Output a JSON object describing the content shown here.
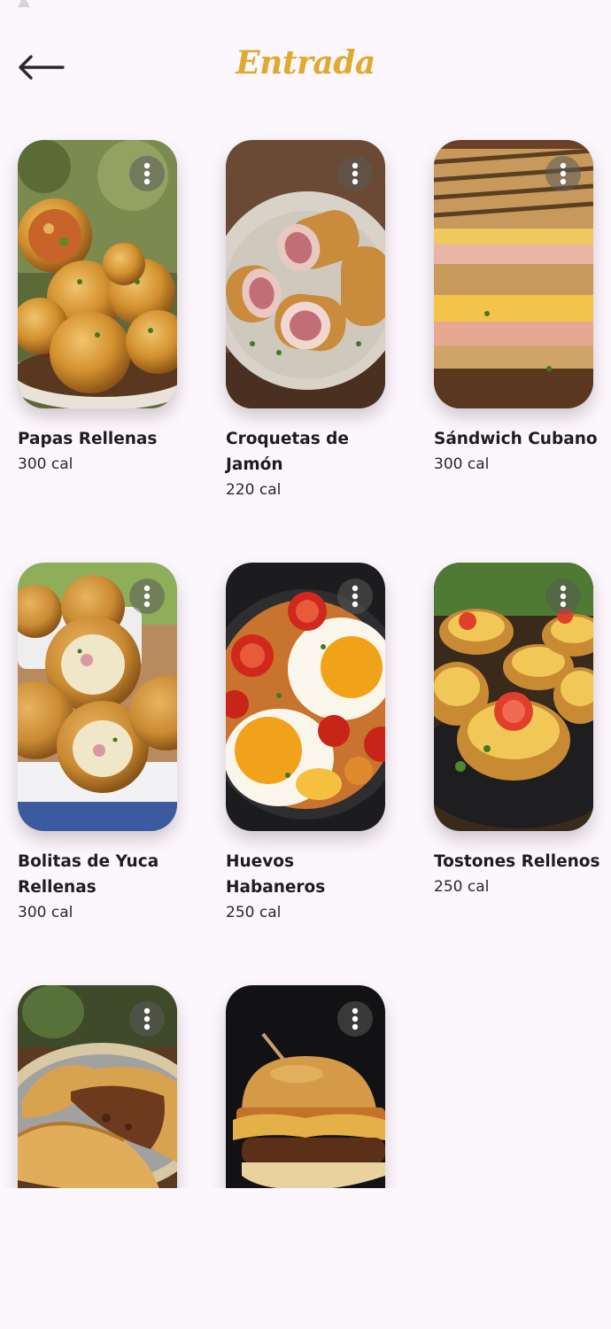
{
  "header": {
    "title": "Entrada",
    "back_icon": "arrow-left-icon",
    "accent_color": "#e0a930"
  },
  "recipes": [
    {
      "name": "Papas Rellenas",
      "calories": "300 cal"
    },
    {
      "name": "Croquetas de Jamón",
      "calories": "220 cal"
    },
    {
      "name": "Sándwich Cubano",
      "calories": "300 cal"
    },
    {
      "name": "Bolitas de Yuca Rellenas",
      "calories": "300 cal"
    },
    {
      "name": "Huevos Habaneros",
      "calories": "250 cal"
    },
    {
      "name": "Tostones Rellenos",
      "calories": "250 cal"
    },
    {
      "name": "",
      "calories": ""
    },
    {
      "name": "",
      "calories": ""
    }
  ],
  "card_menu_icon": "more-vertical-icon"
}
